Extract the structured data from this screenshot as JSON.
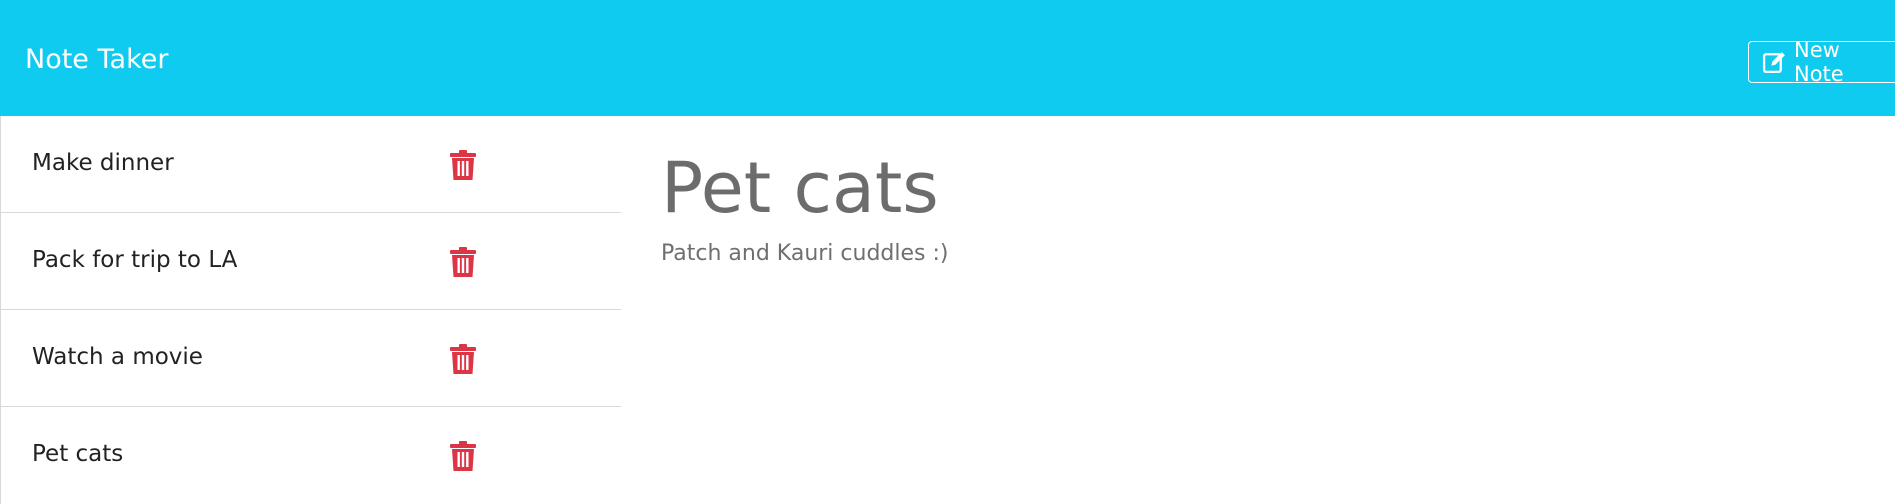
{
  "app": {
    "title": "Note Taker"
  },
  "toolbar": {
    "new_note_label": "New Note",
    "new_note_icon": "pen-to-square-icon"
  },
  "colors": {
    "navbar": "#0fcbef",
    "delete_icon": "#dc3545",
    "heading_text": "#6c6c6c"
  },
  "sidebar": {
    "notes": [
      {
        "title": "Make dinner",
        "delete_icon": "trash-icon"
      },
      {
        "title": "Pack for trip to LA",
        "delete_icon": "trash-icon"
      },
      {
        "title": "Watch a movie",
        "delete_icon": "trash-icon"
      },
      {
        "title": "Pet cats",
        "delete_icon": "trash-icon"
      }
    ]
  },
  "editor": {
    "title": "Pet cats",
    "text": "Patch and Kauri cuddles :)"
  }
}
